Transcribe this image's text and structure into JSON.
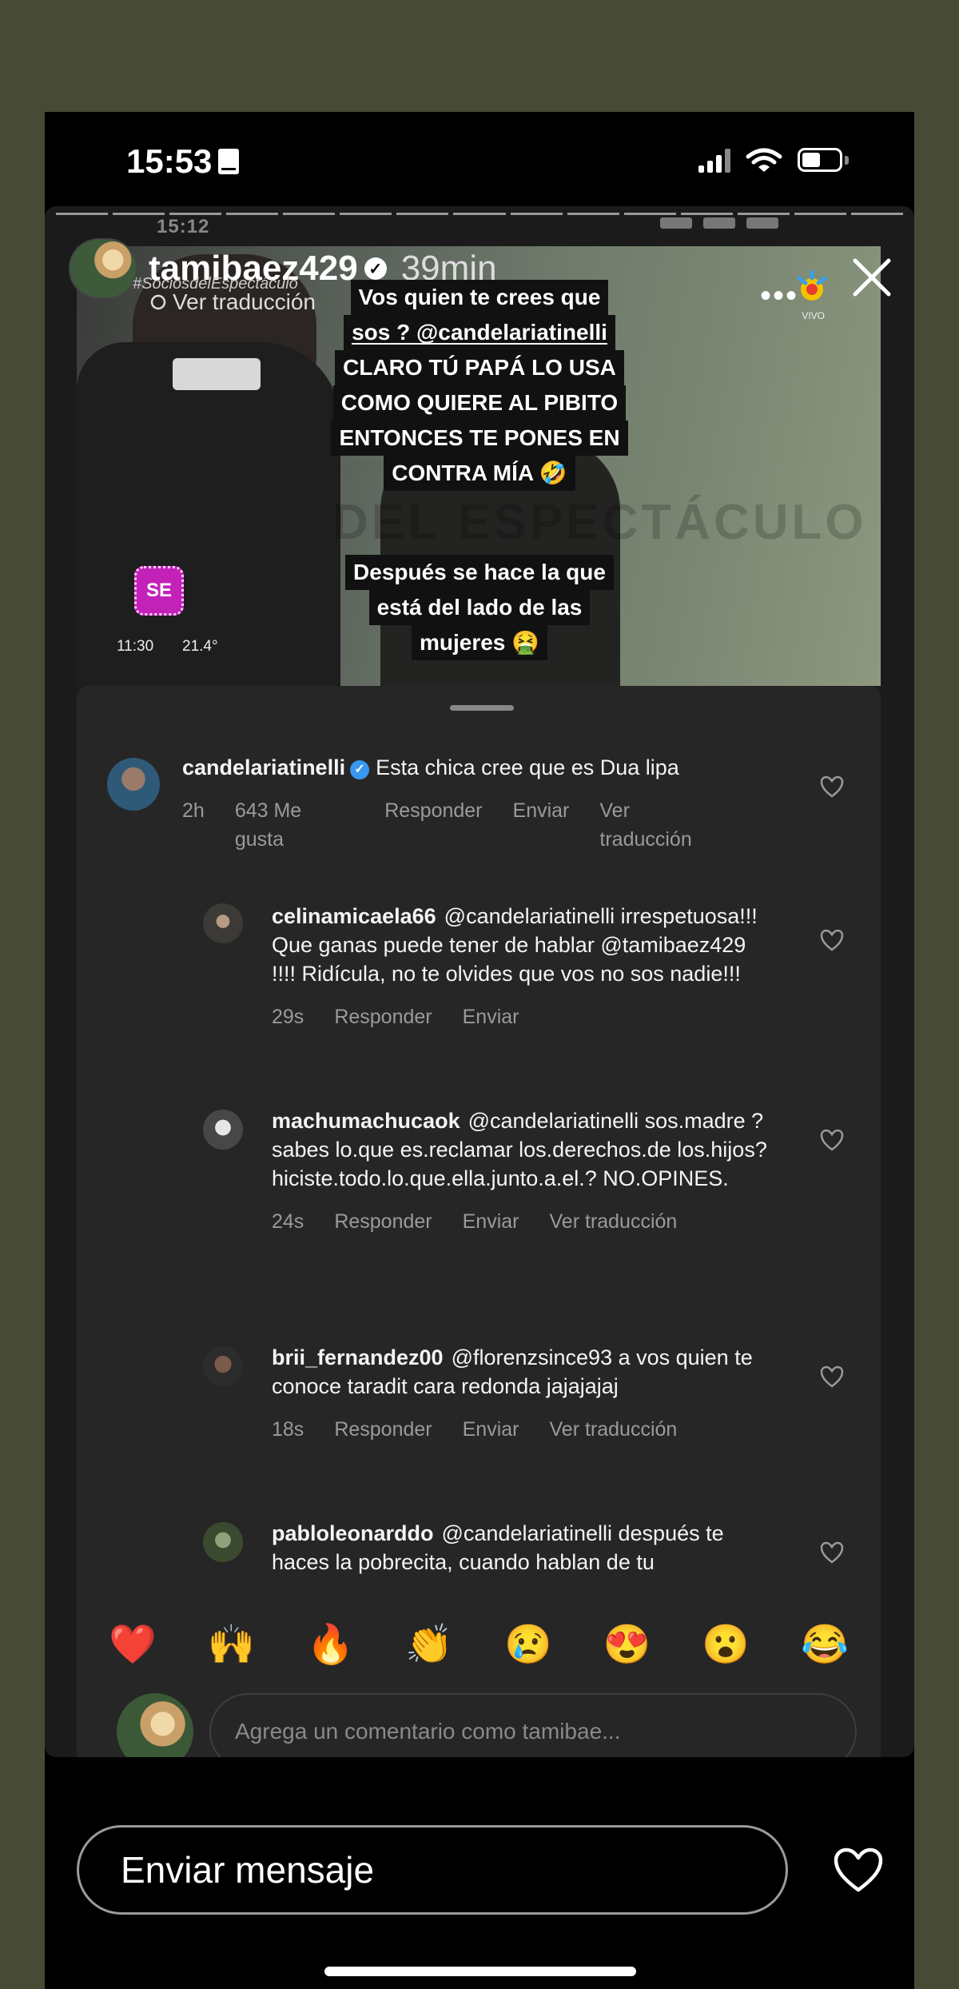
{
  "status_bar": {
    "time": "15:53"
  },
  "story": {
    "ghost_time": "15:12",
    "username": "tamibaez429",
    "time_ago": "39min",
    "ghost_tag": "#SociosdelEspectáculo",
    "translate_link": "Ver traducción",
    "caption_top": [
      "Vos quien te crees que",
      "sos ? @candelariatinelli",
      "CLARO TÚ PAPÁ LO USA",
      "COMO QUIERE AL PIBITO",
      "ENTONCES TE PONES EN",
      "CONTRA MÍA 🤣"
    ],
    "caption_bottom": [
      "Después se hace la que",
      "está del lado de las",
      "mujeres 🤮"
    ],
    "video": {
      "watermark": "DEL ESPECTÁCULO",
      "live_label": "VIVO",
      "se_logo": "SE",
      "clock": "11:30",
      "temperature": "21.4°"
    }
  },
  "comments": [
    {
      "username": "candelariatinelli",
      "verified": true,
      "text": "Esta chica cree que es Dua lipa",
      "time": "2h",
      "likes": "643 Me gusta",
      "reply": "Responder",
      "send": "Enviar",
      "translate": "Ver traducción"
    },
    {
      "username": "celinamicaela66",
      "text": "@candelariatinelli irrespetuosa!!! Que ganas puede tener de hablar @tamibaez429 !!!! Ridícula, no te olvides que vos no sos nadie!!!",
      "time": "29s",
      "reply": "Responder",
      "send": "Enviar"
    },
    {
      "username": "machumachucaok",
      "text": "@candelariatinelli sos.madre ? sabes lo.que es.reclamar los.derechos.de los.hijos? hiciste.todo.lo.que.ella.junto.a.el.? NO.OPINES.",
      "time": "24s",
      "reply": "Responder",
      "send": "Enviar",
      "translate": "Ver traducción"
    },
    {
      "username": "brii_fernandez00",
      "text": "@florenzsince93  a vos quien te conoce taradit cara redonda jajajajaj",
      "time": "18s",
      "reply": "Responder",
      "send": "Enviar",
      "translate": "Ver traducción"
    },
    {
      "username": "pabloleonarddo",
      "text": "@candelariatinelli después te haces la pobrecita, cuando hablan de tu"
    }
  ],
  "emoji_bar": [
    "❤️",
    "🙌",
    "🔥",
    "👏",
    "😢",
    "😍",
    "😮",
    "😂"
  ],
  "compose_placeholder": "Agrega un comentario como tamibae...",
  "send_message": "Enviar mensaje",
  "colors": {
    "background": "#474a34",
    "sheet": "#262626",
    "meta_text": "#9a9a9a"
  }
}
